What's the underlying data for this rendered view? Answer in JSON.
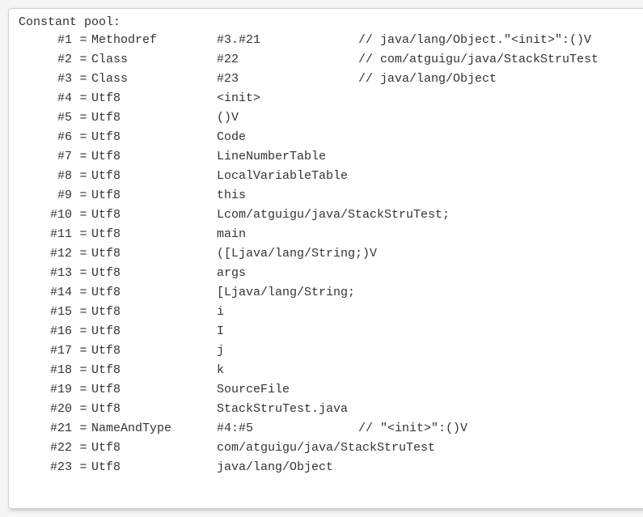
{
  "header": "Constant pool:",
  "entries": [
    {
      "index": "#1",
      "type": "Methodref",
      "value": "#3.#21",
      "comment": "// java/lang/Object.\"<init>\":()V"
    },
    {
      "index": "#2",
      "type": "Class",
      "value": "#22",
      "comment": "// com/atguigu/java/StackStruTest"
    },
    {
      "index": "#3",
      "type": "Class",
      "value": "#23",
      "comment": "// java/lang/Object"
    },
    {
      "index": "#4",
      "type": "Utf8",
      "value": "<init>",
      "comment": ""
    },
    {
      "index": "#5",
      "type": "Utf8",
      "value": "()V",
      "comment": ""
    },
    {
      "index": "#6",
      "type": "Utf8",
      "value": "Code",
      "comment": ""
    },
    {
      "index": "#7",
      "type": "Utf8",
      "value": "LineNumberTable",
      "comment": ""
    },
    {
      "index": "#8",
      "type": "Utf8",
      "value": "LocalVariableTable",
      "comment": ""
    },
    {
      "index": "#9",
      "type": "Utf8",
      "value": "this",
      "comment": ""
    },
    {
      "index": "#10",
      "type": "Utf8",
      "value": "Lcom/atguigu/java/StackStruTest;",
      "comment": ""
    },
    {
      "index": "#11",
      "type": "Utf8",
      "value": "main",
      "comment": ""
    },
    {
      "index": "#12",
      "type": "Utf8",
      "value": "([Ljava/lang/String;)V",
      "comment": ""
    },
    {
      "index": "#13",
      "type": "Utf8",
      "value": "args",
      "comment": ""
    },
    {
      "index": "#14",
      "type": "Utf8",
      "value": "[Ljava/lang/String;",
      "comment": ""
    },
    {
      "index": "#15",
      "type": "Utf8",
      "value": "i",
      "comment": ""
    },
    {
      "index": "#16",
      "type": "Utf8",
      "value": "I",
      "comment": ""
    },
    {
      "index": "#17",
      "type": "Utf8",
      "value": "j",
      "comment": ""
    },
    {
      "index": "#18",
      "type": "Utf8",
      "value": "k",
      "comment": ""
    },
    {
      "index": "#19",
      "type": "Utf8",
      "value": "SourceFile",
      "comment": ""
    },
    {
      "index": "#20",
      "type": "Utf8",
      "value": "StackStruTest.java",
      "comment": ""
    },
    {
      "index": "#21",
      "type": "NameAndType",
      "value": "#4:#5",
      "comment": "// \"<init>\":()V"
    },
    {
      "index": "#22",
      "type": "Utf8",
      "value": "com/atguigu/java/StackStruTest",
      "comment": ""
    },
    {
      "index": "#23",
      "type": "Utf8",
      "value": "java/lang/Object",
      "comment": ""
    }
  ]
}
